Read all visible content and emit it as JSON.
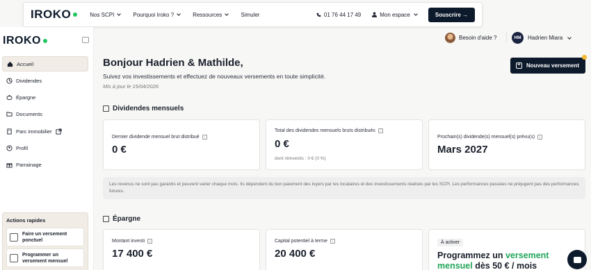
{
  "topnav": {
    "logo": "IROKO",
    "links": [
      "Nos SCPI",
      "Pourquoi Iroko ?",
      "Ressources",
      "Simuler"
    ],
    "phone": "01 76 44 17 49",
    "account": "Mon espace",
    "subscribe": "Souscrire →"
  },
  "sidebar": {
    "logo": "IROKO",
    "items": [
      {
        "label": "Accueil"
      },
      {
        "label": "Dividendes"
      },
      {
        "label": "Épargne"
      },
      {
        "label": "Documents"
      },
      {
        "label": "Parc immobilier"
      },
      {
        "label": "Profil"
      },
      {
        "label": "Parrainage"
      }
    ],
    "quick": {
      "title": "Actions rapides",
      "items": [
        {
          "label": "Faire un versement ponctuel"
        },
        {
          "label": "Programmer un versement mensuel"
        }
      ]
    }
  },
  "header": {
    "help": "Besoin d'aide ?",
    "user_initials": "HM",
    "user_name": "Hadrien Miara"
  },
  "main": {
    "greeting": "Bonjour Hadrien & Mathilde,",
    "subtitle": "Suivez vos investissements et effectuez de nouveaux versements en toute simplicité.",
    "updated": "Mis à jour le 15/04/2026",
    "new_payment": "Nouveau versement",
    "dividends": {
      "title": "Dividendes mensuels",
      "cards": [
        {
          "label": "Dernier dividende mensuel brut distribué",
          "value": "0 €",
          "note": ""
        },
        {
          "label": "Total des dividendes mensuels bruts distribués",
          "value": "0 €",
          "note": "dont réinvestis : 0 € (0 %)"
        },
        {
          "label": "Prochain(s) dividende(s) mensuel(s) prévu(s)",
          "value": "Mars 2027",
          "note": ""
        }
      ],
      "disclaimer": "Les revenus ne sont pas garantis et peuvent varier chaque mois. Ils dépendent du bon paiement des loyers par les locataires et des investissements réalisés par les SCPI. Les performances passées ne préjugent pas des performances futures."
    },
    "savings": {
      "title": "Épargne",
      "cards": [
        {
          "label": "Montant investi",
          "value": "17 400 €"
        },
        {
          "label": "Capital potentiel à terme",
          "value": "20 400 €"
        }
      ],
      "promo": {
        "badge": "À activer",
        "text_1": "Programmez un ",
        "text_green": "versement mensuel",
        "text_2": " dès 50 € / mois"
      }
    }
  }
}
